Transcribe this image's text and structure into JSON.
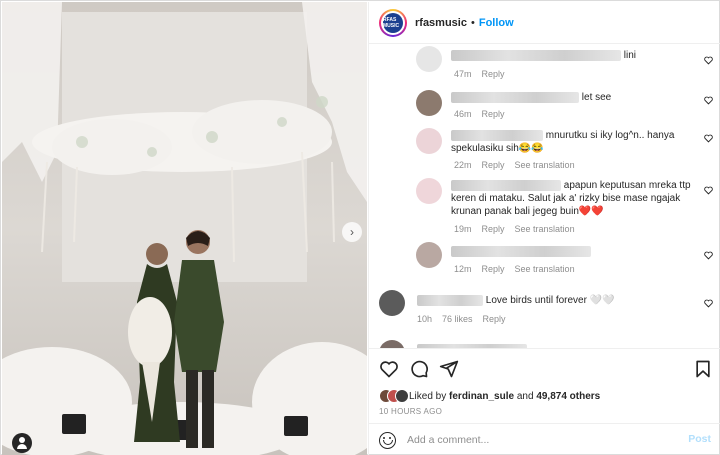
{
  "header": {
    "username": "rfasmusic",
    "separator": "•",
    "follow_label": "Follow",
    "avatar_text": "RFAS MUSIC"
  },
  "comments": [
    {
      "text_end": "lini",
      "time": "47m",
      "reply": "Reply"
    },
    {
      "text_end": "let see",
      "time": "46m",
      "reply": "Reply"
    },
    {
      "text_end": "mnurutku si iky log^n.. hanya spekulasiku sih😂😂",
      "time": "22m",
      "reply": "Reply",
      "translate": "See translation"
    },
    {
      "text_end": "apapun keputusan mreka ttp keren di mataku. Salut jak a' rizky bise mase ngajak krunan panak bali jegeg buin❤️❤️",
      "time": "19m",
      "reply": "Reply",
      "translate": "See translation"
    },
    {
      "text_end": "",
      "time": "12m",
      "reply": "Reply",
      "translate": "See translation"
    },
    {
      "text_end": "Love birds until forever 🤍🤍",
      "time": "10h",
      "likes": "76 likes",
      "reply": "Reply"
    }
  ],
  "actions": {
    "liked_prefix": "Liked by",
    "liked_user": "ferdinan_sule",
    "liked_and": "and",
    "liked_others": "49,874 others",
    "time_ago": "10 HOURS AGO"
  },
  "add_comment": {
    "placeholder": "Add a comment...",
    "post_label": "Post"
  },
  "icons": [
    "heart-icon",
    "comment-icon",
    "share-icon",
    "bookmark-icon",
    "emoji-icon",
    "next-arrow-icon",
    "tag-user-icon"
  ],
  "colors": {
    "accent": "#0095f6",
    "muted": "#8e8e8e",
    "post_disabled": "#b2dffc"
  }
}
